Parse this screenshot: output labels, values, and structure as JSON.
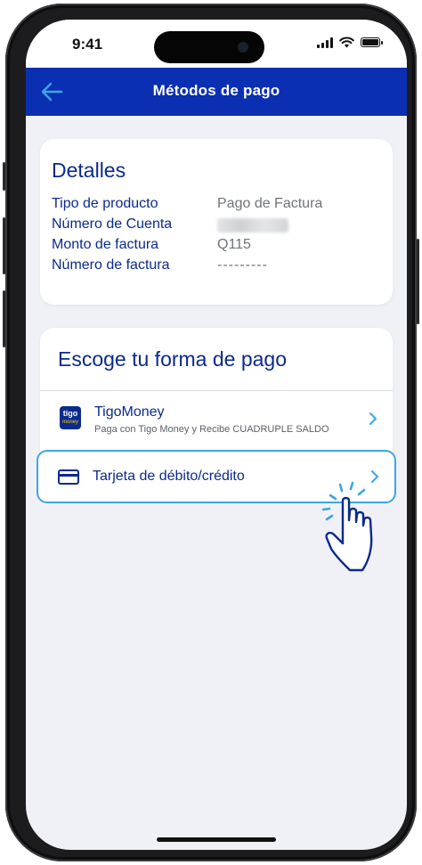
{
  "status_bar": {
    "time": "9:41"
  },
  "app_bar": {
    "title": "Métodos de pago"
  },
  "details": {
    "title": "Detalles",
    "rows": [
      {
        "label": "Tipo de producto",
        "value": "Pago de Factura"
      },
      {
        "label": "Número de Cuenta",
        "value": ""
      },
      {
        "label": "Monto de factura",
        "value": "Q115"
      },
      {
        "label": "Número de factura",
        "value": "---------"
      }
    ]
  },
  "payment": {
    "title": "Escoge tu forma de pago",
    "methods": [
      {
        "name": "TigoMoney",
        "subtitle": "Paga con Tigo Money y Recibe CUADRUPLE SALDO",
        "logo_text": "tigo",
        "logo_sub": "money"
      },
      {
        "name": "Tarjeta de débito/crédito"
      }
    ]
  },
  "colors": {
    "brand_blue": "#0a2fb2",
    "text_blue": "#0a2a8c",
    "highlight": "#3da5e3"
  }
}
